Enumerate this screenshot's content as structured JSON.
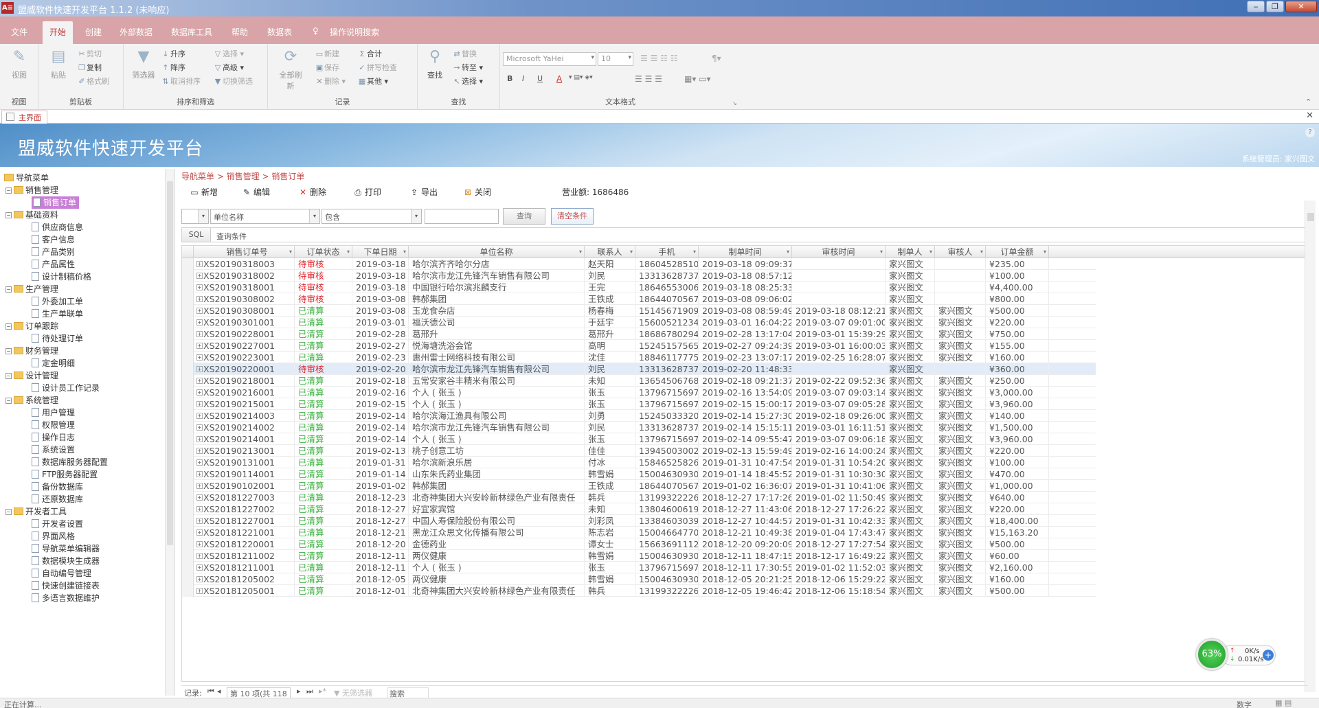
{
  "window": {
    "title": "盟威软件快速开发平台 1.1.2 (未响应)",
    "minimize": "‒",
    "restore": "❐",
    "close": "✕"
  },
  "menu": {
    "items": [
      "文件",
      "开始",
      "创建",
      "外部数据",
      "数据库工具",
      "帮助",
      "数据表"
    ],
    "active": "开始",
    "search": "操作说明搜索"
  },
  "ribbon": {
    "view": {
      "button": "视图",
      "group": "视图"
    },
    "clipboard": {
      "paste": "粘贴",
      "cut": "剪切",
      "copy": "复制",
      "format": "格式刷",
      "group": "剪贴板"
    },
    "sort": {
      "filter": "筛选器",
      "asc": "升序",
      "desc": "降序",
      "remove": "取消排序",
      "select": "选择",
      "advanced": "高级",
      "toggle": "切换筛选",
      "group": "排序和筛选"
    },
    "records": {
      "refresh": "全部刷新",
      "new": "新建",
      "save": "保存",
      "delete": "删除",
      "totals": "合计",
      "spell": "拼写检查",
      "more": "其他",
      "group": "记录"
    },
    "find": {
      "find": "查找",
      "replace": "替换",
      "goto": "转至",
      "select": "选择",
      "group": "查找"
    },
    "textfmt": {
      "font": "Microsoft YaHei",
      "size": "10",
      "bold": "B",
      "italic": "I",
      "underline": "U",
      "fontcolor": "A",
      "group": "文本格式"
    }
  },
  "doctab": {
    "label": "主界面",
    "close": "✕"
  },
  "banner": {
    "title": "盟威软件快速开发平台",
    "user": "系统管理员: 家兴图文",
    "help": "?"
  },
  "sidebar": {
    "root": "导航菜单",
    "groups": [
      {
        "label": "销售管理",
        "items": [
          "销售订单"
        ]
      },
      {
        "label": "基础资料",
        "items": [
          "供应商信息",
          "客户信息",
          "产品类别",
          "产品属性",
          "设计制稿价格"
        ]
      },
      {
        "label": "生产管理",
        "items": [
          "外委加工单",
          "生产单联单"
        ]
      },
      {
        "label": "订单跟踪",
        "items": [
          "待处理订单"
        ]
      },
      {
        "label": "财务管理",
        "items": [
          "定金明细"
        ]
      },
      {
        "label": "设计管理",
        "items": [
          "设计员工作记录"
        ]
      },
      {
        "label": "系统管理",
        "items": [
          "用户管理",
          "权限管理",
          "操作日志",
          "系统设置",
          "数据库服务器配置",
          "FTP服务器配置",
          "备份数据库",
          "还原数据库"
        ]
      },
      {
        "label": "开发者工具",
        "items": [
          "开发者设置",
          "界面风格",
          "导航菜单编辑器",
          "数据模块生成器",
          "自动编号管理",
          "快速创建链接表",
          "多语言数据维护"
        ]
      }
    ],
    "selected": "销售订单"
  },
  "main": {
    "breadcrumb": "导航菜单 > 销售管理 > 销售订单",
    "toolbar": {
      "new": "新增",
      "edit": "编辑",
      "delete": "删除",
      "print": "打印",
      "export": "导出",
      "close": "关闭",
      "revenue_label": "营业额:",
      "revenue_value": "1686486"
    },
    "filter": {
      "field": "单位名称",
      "op": "包含",
      "value": "",
      "query": "查询",
      "clear": "清空条件"
    },
    "sql": {
      "button": "SQL",
      "text": "查询条件"
    },
    "columns": [
      "销售订单号",
      "订单状态",
      "下单日期",
      "单位名称",
      "联系人",
      "手机",
      "制单时间",
      "审核时间",
      "制单人",
      "审核人",
      "订单金额"
    ],
    "rows": [
      [
        "XS20190318003",
        "待审核",
        "2019-03-18",
        "哈尔滨齐齐哈尔分店",
        "赵天阳",
        "18604528510",
        "2019-03-18 09:09:37",
        "",
        "家兴图文",
        "",
        "¥235.00"
      ],
      [
        "XS20190318002",
        "待审核",
        "2019-03-18",
        "哈尔滨市龙江先锋汽车销售有限公司",
        "刘民",
        "13313628737",
        "2019-03-18 08:57:12",
        "",
        "家兴图文",
        "",
        "¥100.00"
      ],
      [
        "XS20190318001",
        "待审核",
        "2019-03-18",
        "中国银行哈尔滨兆麟支行",
        "王完",
        "18646553006",
        "2019-03-18 08:25:33",
        "",
        "家兴图文",
        "",
        "¥4,400.00"
      ],
      [
        "XS20190308002",
        "待审核",
        "2019-03-08",
        "韩郝集团",
        "王铁成",
        "18644070567",
        "2019-03-08 09:06:02",
        "",
        "家兴图文",
        "",
        "¥800.00"
      ],
      [
        "XS20190308001",
        "已清算",
        "2019-03-08",
        "玉龙食杂店",
        "杨春梅",
        "15145671909",
        "2019-03-08 08:59:49",
        "2019-03-18 08:12:21",
        "家兴图文",
        "家兴图文",
        "¥500.00"
      ],
      [
        "XS20190301001",
        "已清算",
        "2019-03-01",
        "福沃德公司",
        "于廷宇",
        "15600521234",
        "2019-03-01 16:04:22",
        "2019-03-07 09:01:00",
        "家兴图文",
        "家兴图文",
        "¥220.00"
      ],
      [
        "XS20190228001",
        "已清算",
        "2019-02-28",
        "葛邢升",
        "葛邢升",
        "18686780294",
        "2019-02-28 13:17:04",
        "2019-03-01 15:39:29",
        "家兴图文",
        "家兴图文",
        "¥750.00"
      ],
      [
        "XS20190227001",
        "已清算",
        "2019-02-27",
        "悦海塘洗浴会馆",
        "高明",
        "15245157565",
        "2019-02-27 09:24:39",
        "2019-03-01 16:00:03",
        "家兴图文",
        "家兴图文",
        "¥155.00"
      ],
      [
        "XS20190223001",
        "已清算",
        "2019-02-23",
        "惠州雷士网络科技有限公司",
        "沈佳",
        "18846117775",
        "2019-02-23 13:07:17",
        "2019-02-25 16:28:07",
        "家兴图文",
        "家兴图文",
        "¥160.00"
      ],
      [
        "XS20190220001",
        "待审核",
        "2019-02-20",
        "哈尔滨市龙江先锋汽车销售有限公司",
        "刘民",
        "13313628737",
        "2019-02-20 11:48:33",
        "",
        "家兴图文",
        "",
        "¥360.00"
      ],
      [
        "XS20190218001",
        "已清算",
        "2019-02-18",
        "五常安家谷丰精米有限公司",
        "未知",
        "13654506768",
        "2019-02-18 09:21:37",
        "2019-02-22 09:52:36",
        "家兴图文",
        "家兴图文",
        "¥250.00"
      ],
      [
        "XS20190216001",
        "已清算",
        "2019-02-16",
        "个人 ( 张玉 )",
        "张玉",
        "13796715697",
        "2019-02-16 13:54:09",
        "2019-03-07 09:03:14",
        "家兴图文",
        "家兴图文",
        "¥3,000.00"
      ],
      [
        "XS20190215001",
        "已清算",
        "2019-02-15",
        "个人 ( 张玉 )",
        "张玉",
        "13796715697",
        "2019-02-15 15:00:17",
        "2019-03-07 09:05:28",
        "家兴图文",
        "家兴图文",
        "¥3,960.00"
      ],
      [
        "XS20190214003",
        "已清算",
        "2019-02-14",
        "哈尔滨海江渔具有限公司",
        "刘勇",
        "15245033320",
        "2019-02-14 15:27:30",
        "2019-02-18 09:26:00",
        "家兴图文",
        "家兴图文",
        "¥140.00"
      ],
      [
        "XS20190214002",
        "已清算",
        "2019-02-14",
        "哈尔滨市龙江先锋汽车销售有限公司",
        "刘民",
        "13313628737",
        "2019-02-14 15:15:11",
        "2019-03-01 16:11:51",
        "家兴图文",
        "家兴图文",
        "¥1,500.00"
      ],
      [
        "XS20190214001",
        "已清算",
        "2019-02-14",
        "个人 ( 张玉 )",
        "张玉",
        "13796715697",
        "2019-02-14 09:55:47",
        "2019-03-07 09:06:18",
        "家兴图文",
        "家兴图文",
        "¥3,960.00"
      ],
      [
        "XS20190213001",
        "已清算",
        "2019-02-13",
        "桃子创意工坊",
        "佳佳",
        "13945003002",
        "2019-02-13 15:59:49",
        "2019-02-16 14:00:24",
        "家兴图文",
        "家兴图文",
        "¥220.00"
      ],
      [
        "XS20190131001",
        "已清算",
        "2019-01-31",
        "哈尔滨新浪乐居",
        "付冰",
        "15846525826",
        "2019-01-31 10:47:54",
        "2019-01-31 10:54:20",
        "家兴图文",
        "家兴图文",
        "¥100.00"
      ],
      [
        "XS20190114001",
        "已清算",
        "2019-01-14",
        "山东朱氏药业集团",
        "韩雪娟",
        "15004630930",
        "2019-01-14 18:45:52",
        "2019-01-31 10:30:30",
        "家兴图文",
        "家兴图文",
        "¥470.00"
      ],
      [
        "XS20190102001",
        "已清算",
        "2019-01-02",
        "韩郝集团",
        "王铁成",
        "18644070567",
        "2019-01-02 16:36:07",
        "2019-01-31 10:41:06",
        "家兴图文",
        "家兴图文",
        "¥1,000.00"
      ],
      [
        "XS20181227003",
        "已清算",
        "2018-12-23",
        "北奇神集团大兴安岭新林绿色产业有限责任",
        "韩兵",
        "13199322226",
        "2018-12-27 17:17:26",
        "2019-01-02 11:50:49",
        "家兴图文",
        "家兴图文",
        "¥640.00"
      ],
      [
        "XS20181227002",
        "已清算",
        "2018-12-27",
        "好宜家宾馆",
        "未知",
        "13804600619",
        "2018-12-27 11:43:06",
        "2018-12-27 17:26:22",
        "家兴图文",
        "家兴图文",
        "¥220.00"
      ],
      [
        "XS20181227001",
        "已清算",
        "2018-12-27",
        "中国人寿保险股份有限公司",
        "刘彩凤",
        "13384603039",
        "2018-12-27 10:44:57",
        "2019-01-31 10:42:33",
        "家兴图文",
        "家兴图文",
        "¥18,400.00"
      ],
      [
        "XS20181221001",
        "已清算",
        "2018-12-21",
        "黑龙江众思文化传播有限公司",
        "陈志岩",
        "15004664770",
        "2018-12-21 10:49:38",
        "2019-01-04 17:43:47",
        "家兴图文",
        "家兴图文",
        "¥15,163.20"
      ],
      [
        "XS20181220001",
        "已清算",
        "2018-12-20",
        "金德药业",
        "谭女士",
        "15663691112",
        "2018-12-20 09:20:09",
        "2018-12-27 17:27:54",
        "家兴图文",
        "家兴图文",
        "¥500.00"
      ],
      [
        "XS20181211002",
        "已清算",
        "2018-12-11",
        "两仪健康",
        "韩雪娟",
        "15004630930",
        "2018-12-11 18:47:15",
        "2018-12-17 16:49:22",
        "家兴图文",
        "家兴图文",
        "¥60.00"
      ],
      [
        "XS20181211001",
        "已清算",
        "2018-12-11",
        "个人 ( 张玉 )",
        "张玉",
        "13796715697",
        "2018-12-11 17:30:55",
        "2019-01-02 11:52:03",
        "家兴图文",
        "家兴图文",
        "¥2,160.00"
      ],
      [
        "XS20181205002",
        "已清算",
        "2018-12-05",
        "两仪健康",
        "韩雪娟",
        "15004630930",
        "2018-12-05 20:21:25",
        "2018-12-06 15:29:22",
        "家兴图文",
        "家兴图文",
        "¥160.00"
      ],
      [
        "XS20181205001",
        "已清算",
        "2018-12-01",
        "北奇神集团大兴安岭新林绿色产业有限责任",
        "韩兵",
        "13199322226",
        "2018-12-05 19:46:42",
        "2018-12-06 15:18:54",
        "家兴图文",
        "家兴图文",
        "¥500.00"
      ]
    ],
    "selected_row": 9,
    "pager": {
      "label": "记录:",
      "position": "第 10 项(共 118",
      "filter": "无筛选器",
      "search": "搜索"
    }
  },
  "status": {
    "left": "正在计算...",
    "right": "数字"
  },
  "netwidget": {
    "percent": "63%",
    "up": "0K/s",
    "down": "0.01K/s",
    "plus": "+"
  },
  "colors": {
    "menubar": "#d9a4a7",
    "accent": "#c44c4c",
    "pending": "#e0242c",
    "settled": "#3ab03e",
    "selection": "#c97fd7"
  }
}
